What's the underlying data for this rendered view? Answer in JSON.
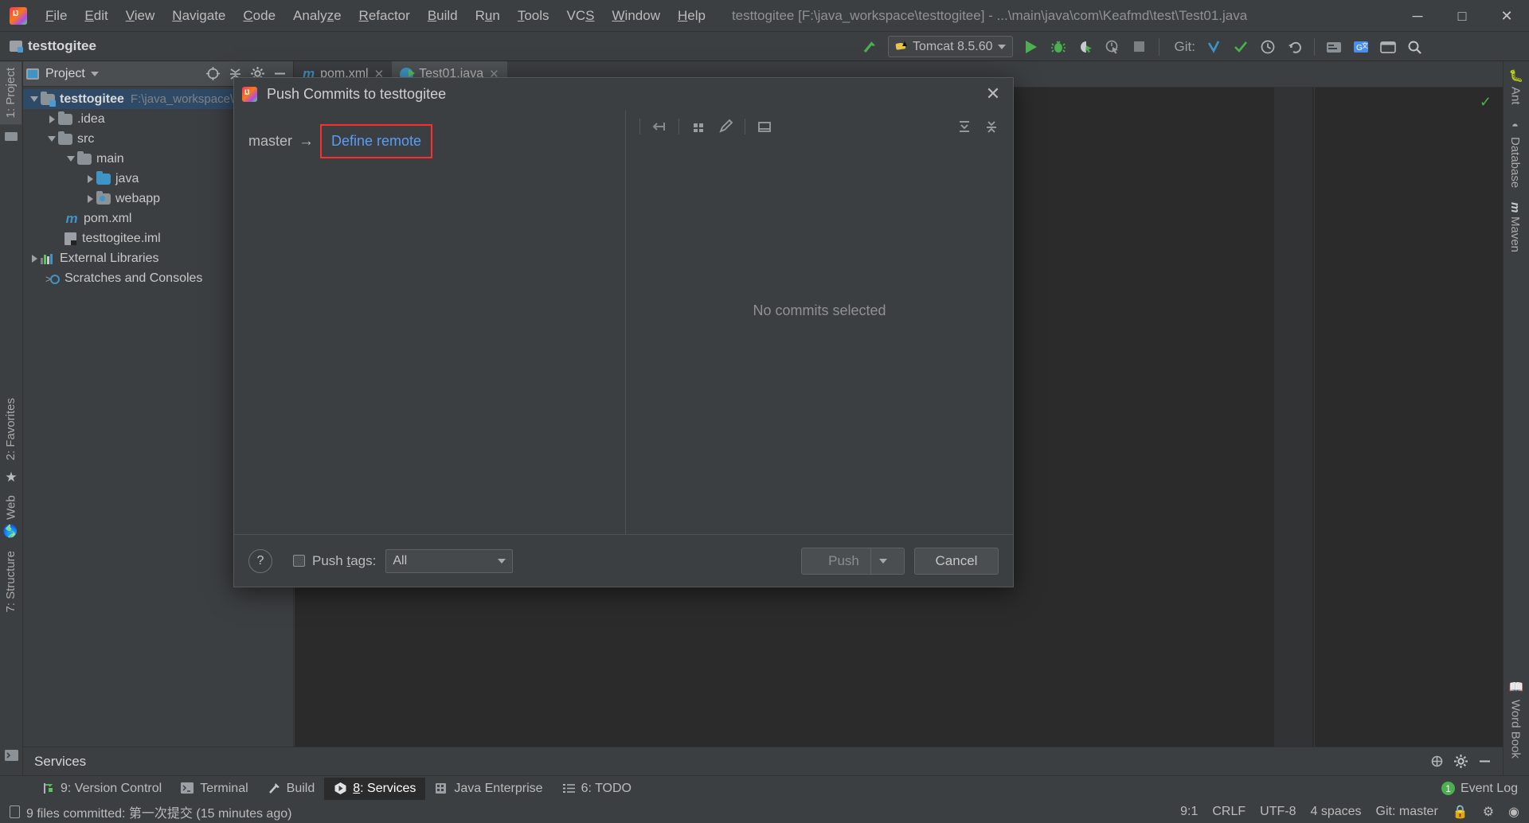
{
  "titlebar": {
    "logo": "intellij-idea-logo",
    "menus": [
      "File",
      "Edit",
      "View",
      "Navigate",
      "Code",
      "Analyze",
      "Refactor",
      "Build",
      "Run",
      "Tools",
      "VCS",
      "Window",
      "Help"
    ],
    "window_title": "testtogitee [F:\\java_workspace\\testtogitee] - ...\\main\\java\\com\\Keafmd\\test\\Test01.java",
    "minimize": "─",
    "maximize": "□",
    "close": "✕"
  },
  "toolbar": {
    "project_name": "testtogitee",
    "run_config": "Tomcat 8.5.60",
    "git_label": "Git:"
  },
  "left_stripe": {
    "project": "1: Project",
    "favorites": "2: Favorites",
    "web": "Web",
    "structure": "7: Structure"
  },
  "right_stripe": {
    "ant": "Ant",
    "database": "Database",
    "maven": "Maven",
    "word_book": "Word Book"
  },
  "project_panel": {
    "header_label": "Project",
    "tree": [
      {
        "label": "testtogitee",
        "path": "F:\\java_workspace\\t",
        "indent": 0,
        "arrow": "down",
        "icon": "folder-module",
        "selected": true,
        "bold": true
      },
      {
        "label": ".idea",
        "path": "",
        "indent": 1,
        "arrow": "right",
        "icon": "folder",
        "selected": false,
        "bold": false
      },
      {
        "label": "src",
        "path": "",
        "indent": 1,
        "arrow": "down",
        "icon": "folder",
        "selected": false,
        "bold": false
      },
      {
        "label": "main",
        "path": "",
        "indent": 2,
        "arrow": "down",
        "icon": "folder",
        "selected": false,
        "bold": false
      },
      {
        "label": "java",
        "path": "",
        "indent": 3,
        "arrow": "right",
        "icon": "folder-source",
        "selected": false,
        "bold": false
      },
      {
        "label": "webapp",
        "path": "",
        "indent": 3,
        "arrow": "right",
        "icon": "folder-web",
        "selected": false,
        "bold": false
      },
      {
        "label": "pom.xml",
        "path": "",
        "indent": 2,
        "arrow": "none",
        "icon": "maven-file",
        "selected": false,
        "bold": false
      },
      {
        "label": "testtogitee.iml",
        "path": "",
        "indent": 2,
        "arrow": "none",
        "icon": "iml-file",
        "selected": false,
        "bold": false
      },
      {
        "label": "External Libraries",
        "path": "",
        "indent": 0,
        "arrow": "right",
        "icon": "libraries",
        "selected": false,
        "bold": false
      },
      {
        "label": "Scratches and Consoles",
        "path": "",
        "indent": 0,
        "arrow": "none",
        "icon": "scratches",
        "selected": false,
        "bold": false
      }
    ]
  },
  "editor": {
    "tabs": [
      {
        "label": "pom.xml",
        "icon": "maven-file-icon",
        "active": false,
        "close": "✕"
      },
      {
        "label": "Test01.java",
        "icon": "java-class-run-icon",
        "active": true,
        "close": "✕"
      }
    ]
  },
  "push_dialog": {
    "title": "Push Commits to testtogitee",
    "close": "✕",
    "branch": "master",
    "arrow": "→",
    "define_remote": "Define remote",
    "no_commits": "No commits selected",
    "help": "?",
    "push_tags_label_pre": "Push ",
    "push_tags_label_accel": "t",
    "push_tags_label_post": "ags:",
    "tags_value": "All",
    "push_button": "Push",
    "cancel_button": "Cancel",
    "highlight_color": "#ff2d2d",
    "link_color": "#589df6"
  },
  "services_panel": {
    "title": "Services"
  },
  "bottom_bar": {
    "items": [
      {
        "label": "9: Version Control",
        "accel": "9",
        "icon": "vcs-icon",
        "active": false
      },
      {
        "label": "Terminal",
        "accel": "",
        "icon": "terminal-icon",
        "active": false
      },
      {
        "label": "Build",
        "accel": "",
        "icon": "build-hammer-icon",
        "active": false
      },
      {
        "label": "8: Services",
        "accel": "8",
        "icon": "services-icon",
        "active": true
      },
      {
        "label": "Java Enterprise",
        "accel": "",
        "icon": "java-enterprise-icon",
        "active": false
      },
      {
        "label": "6: TODO",
        "accel": "6",
        "icon": "todo-list-icon",
        "active": false
      }
    ],
    "event_log": "Event Log",
    "event_count": "1"
  },
  "status_bar": {
    "message": "9 files committed: 第一次提交 (15 minutes ago)",
    "caret": "9:1",
    "line_sep": "CRLF",
    "encoding": "UTF-8",
    "indent": "4 spaces",
    "branch": "Git: master"
  }
}
